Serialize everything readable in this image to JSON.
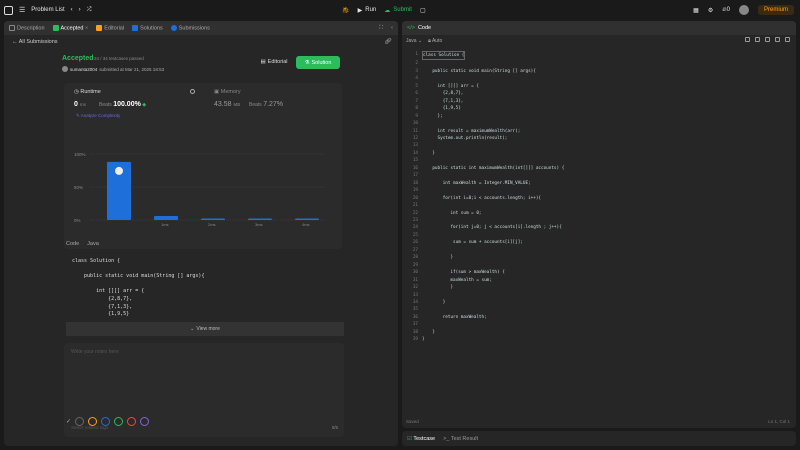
{
  "topbar": {
    "title": "Problem List",
    "run_label": "Run",
    "submit_label": "Submit",
    "streak_count": "0",
    "premium_label": "Premium"
  },
  "left_tabs": [
    "Description",
    "Accepted",
    "Editorial",
    "Solutions",
    "Submissions"
  ],
  "submission": {
    "all_submissions": "All Submissions",
    "status": "Accepted",
    "passed": "34 / 34 testcases passed",
    "username": "sumanta2004",
    "submitted_at": "submitted at Mar 21, 2025 18:53",
    "editorial_btn": "Editorial",
    "solution_btn": "Solution"
  },
  "stats": {
    "runtime_label": "Runtime",
    "runtime_value": "0",
    "runtime_unit": "ms",
    "beats_label": "Beats",
    "beats_value": "100.00%",
    "analyze": "Analyze Complexity",
    "memory_label": "Memory",
    "memory_value": "43.58",
    "memory_unit": "MB",
    "memory_beats_value": "7.27%"
  },
  "chart_data": {
    "type": "bar",
    "categories": [
      "0ms",
      "1ms",
      "2ms",
      "3ms",
      "4ms"
    ],
    "values": [
      88,
      6,
      2,
      2,
      2
    ],
    "ylim": [
      0,
      100
    ],
    "y_ticks": [
      "100%",
      "50%",
      "0%"
    ],
    "bar_color": "#1e6fd9",
    "axis_labels": [
      "1ms",
      "2ms",
      "3ms",
      "4ms"
    ],
    "under_labels": [
      "1ms",
      "2ms",
      "3ms",
      "4ms"
    ]
  },
  "code_preview": {
    "label": "Code",
    "lang": "Java",
    "lines": [
      "class Solution {",
      "",
      "    public static void main(String [] args){",
      "",
      "        int [][] arr = {",
      "            {2,8,7},",
      "            {7,1,3},",
      "            {1,9,5}"
    ],
    "view_more": "View more"
  },
  "notes": {
    "placeholder": "Write your notes here",
    "tags_placeholder": "Select related tags",
    "counter": "0/5"
  },
  "color_dots": [
    "#666666",
    "#ffa116",
    "#1e6fd9",
    "#2cbb5d",
    "#ef4743",
    "#8a63d2"
  ],
  "editor": {
    "title": "Code",
    "language": "Java",
    "mode": "Auto",
    "status": "Saved",
    "cursor": "Ln 1, Col 1",
    "lines": [
      "class Solution {",
      "",
      "    public static void main(String [] args){",
      "",
      "      int [][] arr = {",
      "        {2,8,7},",
      "        {7,1,3},",
      "        {1,9,5}",
      "      };",
      "",
      "      int result = maximumWealth(arr);",
      "      System.out.println(result);",
      "",
      "    }",
      "",
      "    public static int maximumWealth(int[][] accounts) {",
      "",
      "        int maxWealth = Integer.MIN_VALUE;",
      "",
      "        for(int i=0;i < accounts.length; i++){",
      "",
      "           int sum = 0;",
      "",
      "           for(int j=0; j < accounts[i].length ; j++){",
      "",
      "            sum = sum + accounts[i][j];",
      "",
      "           }",
      "",
      "           if(sum > maxWealth) {",
      "           maxWealth = sum;",
      "           }",
      "",
      "        }",
      "",
      "        return maxWealth;",
      "",
      "    }",
      "}"
    ]
  },
  "bottom_tabs": [
    "Testcase",
    "Test Result"
  ]
}
